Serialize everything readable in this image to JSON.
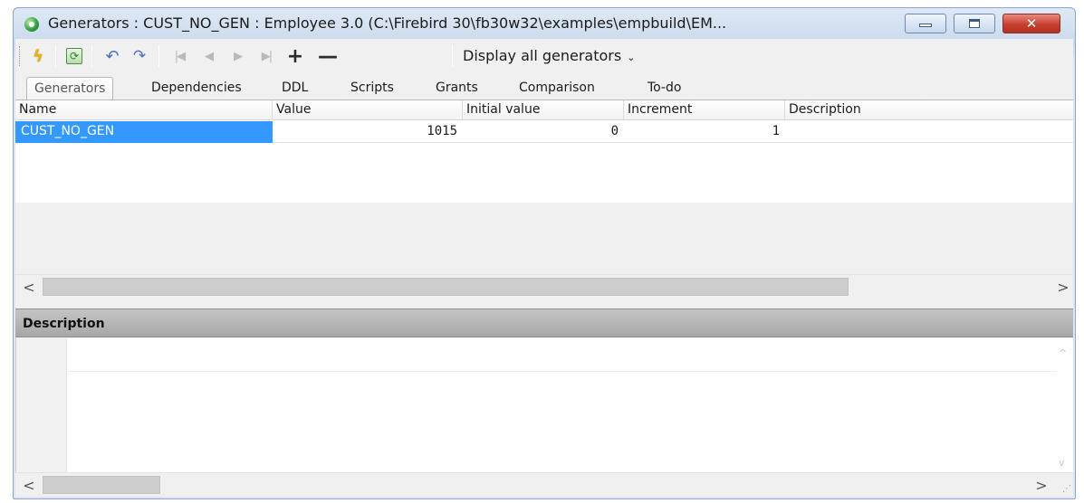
{
  "window": {
    "title": "Generators : CUST_NO_GEN : Employee 3.0 (C:\\Firebird 30\\fb30w32\\examples\\empbuild\\EM...",
    "close_glyph": "✕"
  },
  "toolbar": {
    "compile_glyph": "ϟ",
    "refresh_glyph": "⟳",
    "undo_glyph": "↶",
    "redo_glyph": "↷",
    "first_glyph": "|◀",
    "prev_glyph": "◀",
    "next_glyph": "▶",
    "last_glyph": "▶|",
    "add_glyph": "+",
    "remove_glyph": "—",
    "display_filter": "Display all generators",
    "display_chevron": "⌄"
  },
  "tabs": [
    {
      "label": "Generators",
      "active": true
    },
    {
      "label": "Dependencies"
    },
    {
      "label": "DDL"
    },
    {
      "label": "Scripts"
    },
    {
      "label": "Grants"
    },
    {
      "label": "Comparison"
    },
    {
      "label": "To-do"
    }
  ],
  "grid": {
    "columns": [
      "Name",
      "Value",
      "Initial value",
      "Increment",
      "Description"
    ],
    "rows": [
      {
        "name": "CUST_NO_GEN",
        "value": "1015",
        "initial_value": "0",
        "increment": "1",
        "description": ""
      }
    ]
  },
  "scroll": {
    "left_glyph": "<",
    "right_glyph": ">"
  },
  "description_panel": {
    "title": "Description",
    "up_glyph": "^",
    "down_glyph": "v",
    "grip_glyph": "⋰"
  },
  "icons": {
    "app": "firebird-app-icon",
    "compile": "lightning-icon",
    "refresh": "refresh-icon",
    "undo": "undo-icon",
    "redo": "redo-icon"
  },
  "colors": {
    "selection": "#3399ff",
    "title_bar": "#c9d9ec",
    "close_button": "#c7402f"
  }
}
